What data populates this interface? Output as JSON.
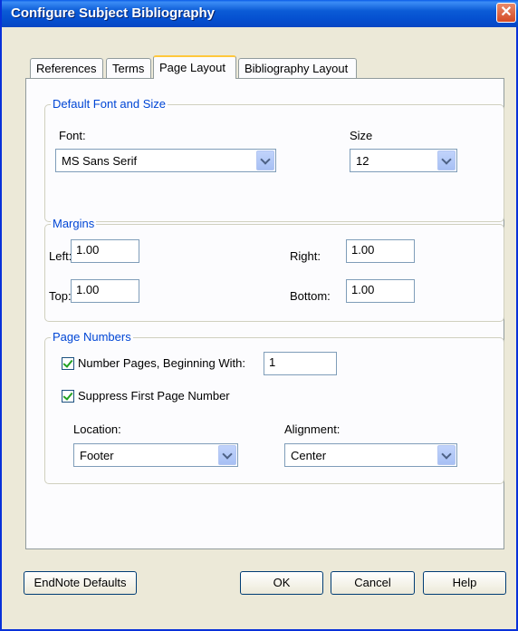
{
  "window": {
    "title": "Configure Subject Bibliography"
  },
  "tabs": [
    {
      "label": "References"
    },
    {
      "label": "Terms"
    },
    {
      "label": "Page Layout"
    },
    {
      "label": "Bibliography Layout"
    }
  ],
  "font_group": {
    "legend": "Default Font and Size",
    "font_label": "Font:",
    "font_value": "MS Sans Serif",
    "size_label": "Size",
    "size_value": "12"
  },
  "margins_group": {
    "legend": "Margins",
    "left_label": "Left:",
    "left_value": "1.00",
    "right_label": "Right:",
    "right_value": "1.00",
    "top_label": "Top:",
    "top_value": "1.00",
    "bottom_label": "Bottom:",
    "bottom_value": "1.00"
  },
  "page_numbers_group": {
    "legend": "Page Numbers",
    "number_pages_label": "Number Pages, Beginning With:",
    "number_pages_checked": true,
    "beginning_value": "1",
    "suppress_label": "Suppress First Page Number",
    "suppress_checked": true,
    "location_label": "Location:",
    "location_value": "Footer",
    "alignment_label": "Alignment:",
    "alignment_value": "Center"
  },
  "buttons": {
    "endnote_defaults": "EndNote Defaults",
    "ok": "OK",
    "cancel": "Cancel",
    "help": "Help"
  }
}
